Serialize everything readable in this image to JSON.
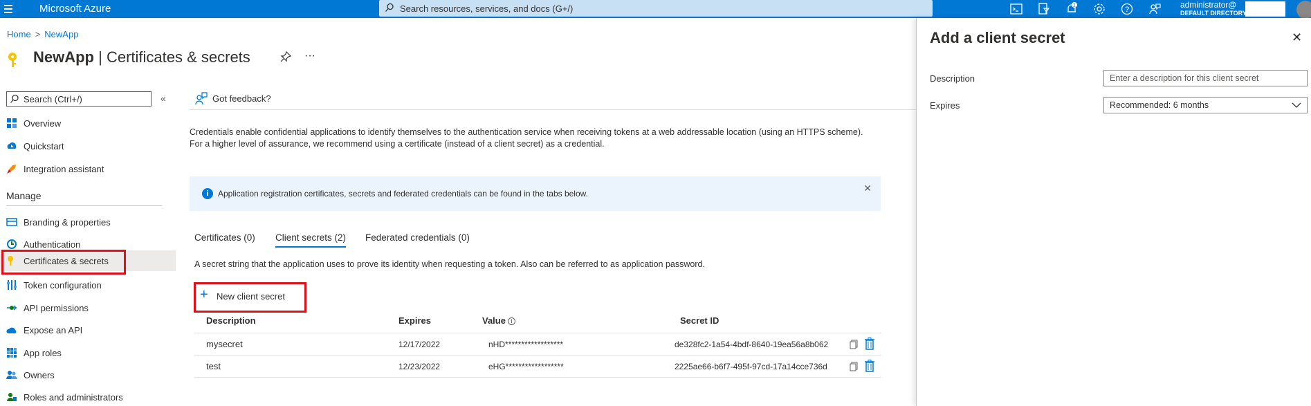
{
  "topbar": {
    "brand": "Microsoft Azure",
    "search_placeholder": "Search resources, services, and docs (G+/)",
    "notification_count": "1",
    "user_name": "administrator@",
    "user_directory": "DEFAULT DIRECTORY",
    "icons": [
      "cloud-shell-icon",
      "directory-filter-icon",
      "notifications-icon",
      "settings-icon",
      "help-icon",
      "feedback-icon"
    ]
  },
  "breadcrumb": {
    "home": "Home",
    "separator": ">",
    "app": "NewApp"
  },
  "page": {
    "title_app": "NewApp",
    "title_sep": " | ",
    "title_section": "Certificates & secrets",
    "more": "···"
  },
  "sidebar": {
    "search_placeholder": "Search (Ctrl+/)",
    "collapse": "«",
    "items_top": [
      {
        "label": "Overview",
        "icon": "overview-icon"
      },
      {
        "label": "Quickstart",
        "icon": "quickstart-icon"
      },
      {
        "label": "Integration assistant",
        "icon": "rocket-icon"
      }
    ],
    "section": "Manage",
    "items_manage": [
      {
        "label": "Branding & properties",
        "icon": "branding-icon"
      },
      {
        "label": "Authentication",
        "icon": "authentication-icon"
      },
      {
        "label": "Certificates & secrets",
        "icon": "key-icon"
      },
      {
        "label": "Token configuration",
        "icon": "token-icon"
      },
      {
        "label": "API permissions",
        "icon": "api-permissions-icon"
      },
      {
        "label": "Expose an API",
        "icon": "cloud-icon"
      },
      {
        "label": "App roles",
        "icon": "app-roles-icon"
      },
      {
        "label": "Owners",
        "icon": "owners-icon"
      },
      {
        "label": "Roles and administrators",
        "icon": "roles-icon"
      }
    ]
  },
  "main": {
    "feedback": "Got feedback?",
    "description": "Credentials enable confidential applications to identify themselves to the authentication service when receiving tokens at a web addressable location (using an HTTPS scheme). For a higher level of assurance, we recommend using a certificate (instead of a client secret) as a credential.",
    "info_banner": "Application registration certificates, secrets and federated credentials can be found in the tabs below.",
    "tabs": [
      {
        "label": "Certificates (0)"
      },
      {
        "label": "Client secrets (2)"
      },
      {
        "label": "Federated credentials (0)"
      }
    ],
    "secret_description": "A secret string that the application uses to prove its identity when requesting a token. Also can be referred to as application password.",
    "new_secret_button": "New client secret",
    "table": {
      "headers": [
        "Description",
        "Expires",
        "Value",
        "Secret ID"
      ],
      "rows": [
        {
          "description": "mysecret",
          "expires": "12/17/2022",
          "value": "nHD******************",
          "secret_id": "de328fc2-1a54-4bdf-8640-19ea56a8b062"
        },
        {
          "description": "test",
          "expires": "12/23/2022",
          "value": "eHG******************",
          "secret_id": "2225ae66-b6f7-495f-97cd-17a14cce736d"
        }
      ]
    }
  },
  "panel": {
    "title": "Add a client secret",
    "close": "✕",
    "description_label": "Description",
    "description_placeholder": "Enter a description for this client secret",
    "expires_label": "Expires",
    "expires_value": "Recommended: 6 months"
  },
  "colors": {
    "accent": "#0078d4",
    "highlight": "#e0101b",
    "info_bg": "#ebf3fc"
  }
}
